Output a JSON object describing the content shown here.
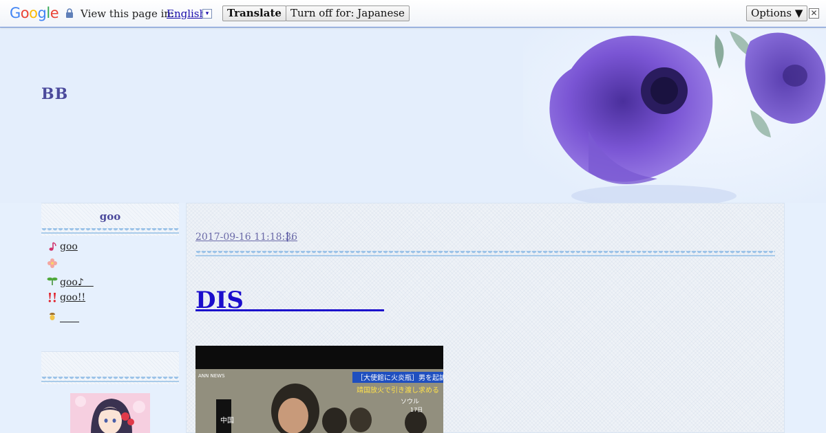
{
  "translate_bar": {
    "logo": "Google",
    "label": "View this page in:",
    "language": "English",
    "language_arrow": "▾",
    "translate_button": "Translate",
    "turn_off_button": "Turn off for: Japanese",
    "options_button": "Options ▼",
    "close_glyph": "✕"
  },
  "header": {
    "title": "BB"
  },
  "sidebar": {
    "box_title": "goo",
    "items": [
      {
        "icon": "music-note-icon",
        "label": "goo"
      },
      {
        "icon": "flower-icon",
        "label": ""
      },
      {
        "icon": "sprout-icon",
        "label": "goo♪　"
      },
      {
        "icon": "exclamation-icon",
        "label": "goo!!"
      },
      {
        "icon": "acorn-icon",
        "label": "　　"
      }
    ]
  },
  "post": {
    "date": "2017-09-16 11:18:36",
    "separator": "|",
    "category": ".",
    "title": "DIS　　　　　　",
    "image_caption_top": "［大使館に火炎瓶］男を起訴",
    "image_caption_sub": "靖国放火で引き渡し求める",
    "image_location": "ソウル",
    "image_day": "17日",
    "image_logo": "ANN NEWS",
    "image_side": "中国"
  },
  "colors": {
    "accent": "#4b4a9c",
    "link": "#1a0dcc",
    "background": "#e6f0fd"
  }
}
